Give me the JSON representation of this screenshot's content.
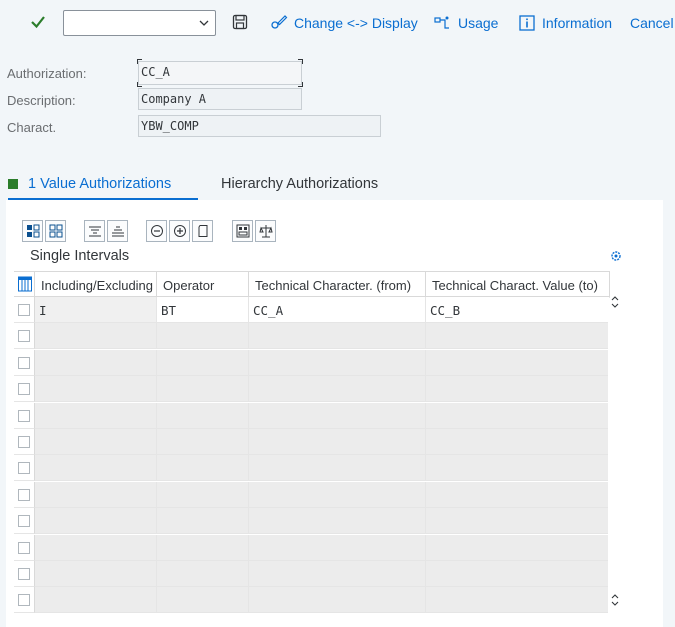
{
  "toolbar": {
    "command_value": "",
    "change_display_label": "Change <-> Display",
    "usage_label": "Usage",
    "information_label": "Information",
    "cancel_label": "Cancel"
  },
  "form": {
    "authorization_label": "Authorization:",
    "authorization_value": "CC_A",
    "description_label": "Description:",
    "description_value": "Company A",
    "charact_label": "Charact.",
    "charact_value": "YBW_COMP"
  },
  "tabs": {
    "active_count": "1",
    "active_label": "Value Authorizations",
    "inactive_label": "Hierarchy Authorizations"
  },
  "section": {
    "title": "Single Intervals"
  },
  "table": {
    "columns": [
      "Including/Excluding",
      "Operator",
      "Technical Character. (from)",
      "Technical Charact. Value (to)"
    ],
    "rows": [
      [
        "I",
        "BT",
        "CC_A",
        "CC_B"
      ]
    ],
    "empty_rows": 11
  },
  "colors": {
    "accent": "#0a6ed1",
    "tab_marker": "#2b7d2b"
  }
}
